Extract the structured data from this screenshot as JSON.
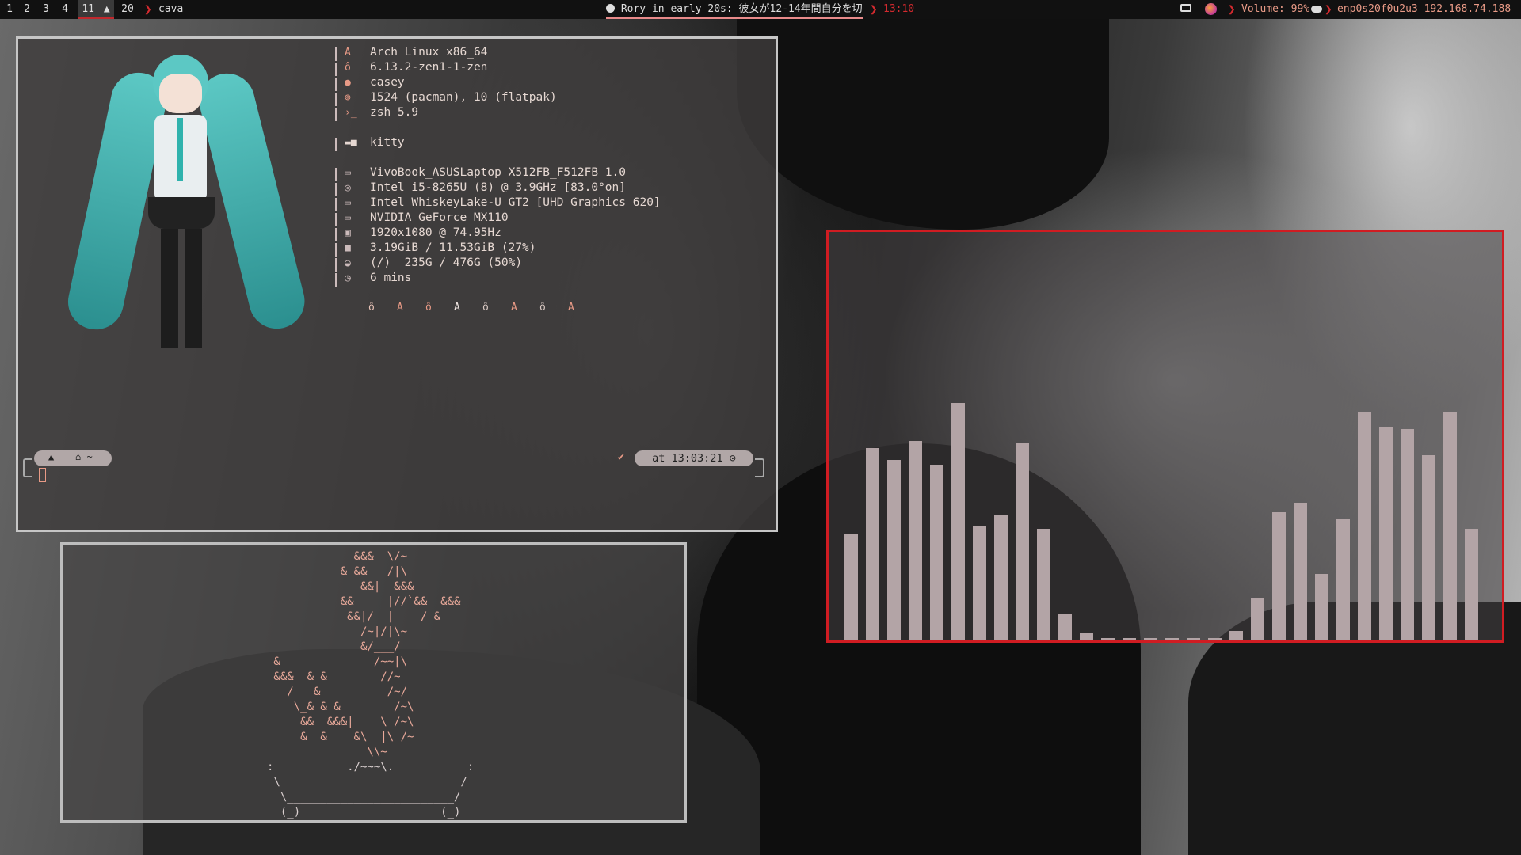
{
  "bar": {
    "workspaces": [
      "1",
      "2",
      "3",
      "4",
      "11",
      "20"
    ],
    "active_workspace": "11",
    "arrow": "❯",
    "window_title": "cava",
    "media": "Rory in early 20s: 彼女が12-14年間自分を切",
    "clock": "13:10",
    "volume": "Volume: 99%",
    "network": "enp0s20f0u2u3 192.168.74.188"
  },
  "fetch": {
    "lines": [
      "Arch Linux x86_64",
      "6.13.2-zen1-1-zen",
      "casey",
      "1524 (pacman), 10 (flatpak)",
      "zsh 5.9",
      "kitty",
      "VivoBook_ASUSLaptop X512FB_F512FB 1.0",
      "Intel i5-8265U (8) @ 3.9GHz [83.0°on]",
      "Intel WhiskeyLake-U GT2 [UHD Graphics 620]",
      "NVIDIA GeForce MX110",
      "1920x1080 @ 74.95Hz",
      "3.19GiB / 11.53GiB (27%)",
      "(/)  235G / 476G (50%)",
      "6 mins"
    ],
    "palette": [
      "ô",
      "A",
      "ô",
      "A",
      "ô",
      "A",
      "ô",
      "A"
    ]
  },
  "prompt": {
    "home": "⌂ ~",
    "check": "✔",
    "time": "at 13:03:21 ⊙"
  },
  "ascii_bonsai": [
    "             &&&  \\/~",
    "           & &&   /|\\",
    "              &&|  &&&",
    "           &&     |//`&&  &&&",
    "            &&|/  |    / &",
    "              /~|/|\\~",
    "              &/___/",
    " &              /~~|\\",
    " &&&  & &        //~",
    "   /   &          /~/",
    "    \\_& & &        /~\\",
    "     &&  &&&|    \\_/~\\",
    "     &  &    &\\__|\\_/~",
    "               \\\\~",
    ":___________./~~~\\.___________:",
    " \\                           /",
    "  \\_________________________/",
    "  (_)                     (_)"
  ],
  "cava": {
    "values": [
      0.45,
      0.81,
      0.76,
      0.84,
      0.74,
      1.0,
      0.48,
      0.53,
      0.83,
      0.47,
      0.11,
      0.03,
      0.01,
      0.01,
      0.01,
      0.01,
      0.01,
      0.01,
      0.04,
      0.18,
      0.54,
      0.58,
      0.28,
      0.51,
      0.96,
      0.9,
      0.89,
      0.78,
      0.96,
      0.47
    ],
    "color": "#b3a4a6"
  },
  "colors": {
    "accent": "#d01c22",
    "text": "#e6d8d2",
    "icon": "#e89a86"
  }
}
